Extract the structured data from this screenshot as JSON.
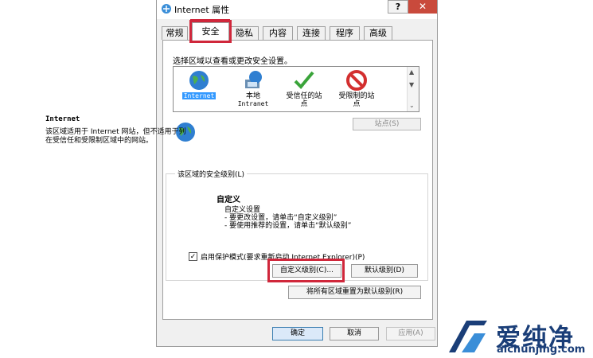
{
  "window": {
    "title": "Internet 属性",
    "help": "?",
    "close": "✕"
  },
  "tabs": [
    {
      "label": "常规"
    },
    {
      "label": "安全"
    },
    {
      "label": "隐私"
    },
    {
      "label": "内容"
    },
    {
      "label": "连接"
    },
    {
      "label": "程序"
    },
    {
      "label": "高级"
    }
  ],
  "zones": {
    "heading": "选择区域以查看或更改安全设置。",
    "items": [
      {
        "label": "Internet",
        "icon": "globe-icon"
      },
      {
        "label": "本地",
        "sub": "Intranet",
        "icon": "local-intranet-icon"
      },
      {
        "label": "受信任的站",
        "sub": "点",
        "icon": "checkmark-icon"
      },
      {
        "label": "受限制的站",
        "sub": "点",
        "icon": "restricted-icon"
      }
    ]
  },
  "zone_info": {
    "title": "Internet",
    "description": "该区域适用于 Internet 网站，但不适用于列在受信任和受限制区域中的网站。",
    "sites_button": "站点(S)"
  },
  "security_level": {
    "group_title": "该区域的安全级别(L)",
    "level_name": "自定义",
    "lines": [
      "自定义设置",
      "- 要更改设置，请单击“自定义级别”",
      "- 要使用推荐的设置，请单击“默认级别”"
    ],
    "protected_mode": "启用保护模式(要求重新启动 Internet Explorer)(P)",
    "protected_checked": "✓",
    "custom_button": "自定义级别(C)...",
    "default_button": "默认级别(D)",
    "reset_button": "将所有区域重置为默认级别(R)"
  },
  "footer": {
    "ok": "确定",
    "cancel": "取消",
    "apply": "应用(A)"
  },
  "watermark": {
    "name": "爱纯净",
    "url": "aichunjing.com"
  },
  "colors": {
    "highlight": "#d0273b",
    "selection": "#3399ff",
    "brand": "#1a3e78"
  }
}
